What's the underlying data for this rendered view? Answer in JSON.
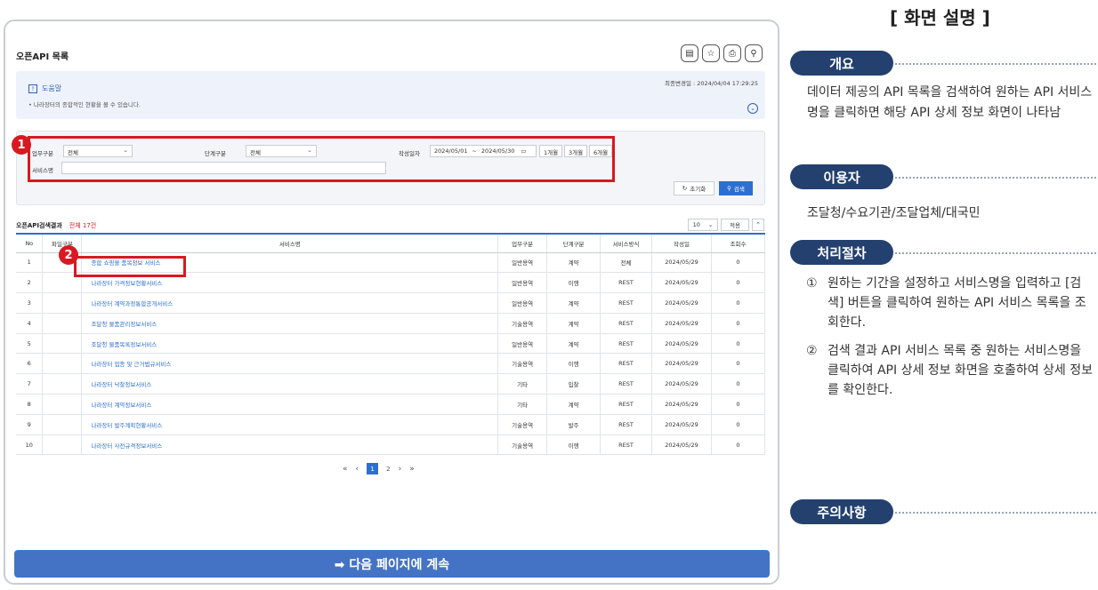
{
  "screen": {
    "title": "오픈API 목록",
    "tool_icons": [
      "bookmark-icon",
      "star-icon",
      "print-icon",
      "search-icon"
    ],
    "help": {
      "title": "도움말",
      "text": "• 나라장터의 종합적인 현황을 볼 수 있습니다.",
      "updated": "최종변경일 : 2024/04/04 17:29:25"
    },
    "search": {
      "task_label": "업무구분",
      "task_value": "전체",
      "stage_label": "단계구분",
      "stage_value": "전체",
      "date_label": "작성일자",
      "date_from": "2024/05/01",
      "date_sep": "~",
      "date_to": "2024/05/30",
      "quick": [
        "1개월",
        "3개월",
        "6개월"
      ],
      "service_label": "서비스명",
      "service_value": "",
      "reset_label": "초기화",
      "search_label": "검색"
    },
    "results": {
      "title": "오픈API검색결과",
      "count_label": "전체 17건",
      "page_size": "10",
      "apply_label": "적용",
      "columns": [
        "No",
        "파일구분",
        "서비스명",
        "업무구분",
        "단계구분",
        "서비스방식",
        "작성일",
        "조회수"
      ],
      "rows": [
        {
          "no": "1",
          "file": "",
          "service": "종합 쇼핑몰 품목정보 서비스",
          "task": "일반용역",
          "stage": "계약",
          "method": "전체",
          "date": "2024/05/29",
          "views": "0"
        },
        {
          "no": "2",
          "file": "",
          "service": "나라장터 가격정보현황서비스",
          "task": "일반용역",
          "stage": "이행",
          "method": "REST",
          "date": "2024/05/29",
          "views": "0"
        },
        {
          "no": "3",
          "file": "",
          "service": "나라장터 계약과정통합공개서비스",
          "task": "일반용역",
          "stage": "계약",
          "method": "REST",
          "date": "2024/05/29",
          "views": "0"
        },
        {
          "no": "4",
          "file": "",
          "service": "조달청 물품관리정보서비스",
          "task": "기술용역",
          "stage": "계약",
          "method": "REST",
          "date": "2024/05/29",
          "views": "0"
        },
        {
          "no": "5",
          "file": "",
          "service": "조달청 물품목록정보서비스",
          "task": "일반용역",
          "stage": "계약",
          "method": "REST",
          "date": "2024/05/29",
          "views": "0"
        },
        {
          "no": "6",
          "file": "",
          "service": "나라장터 업종 및 근거법규서비스",
          "task": "기술용역",
          "stage": "이행",
          "method": "REST",
          "date": "2024/05/29",
          "views": "0"
        },
        {
          "no": "7",
          "file": "",
          "service": "나라장터 낙찰정보서비스",
          "task": "기타",
          "stage": "입찰",
          "method": "REST",
          "date": "2024/05/29",
          "views": "0"
        },
        {
          "no": "8",
          "file": "",
          "service": "나라장터 계약정보서비스",
          "task": "기타",
          "stage": "계약",
          "method": "REST",
          "date": "2024/05/29",
          "views": "0"
        },
        {
          "no": "9",
          "file": "",
          "service": "나라장터 발주계획현황서비스",
          "task": "기술용역",
          "stage": "발주",
          "method": "REST",
          "date": "2024/05/29",
          "views": "0"
        },
        {
          "no": "10",
          "file": "",
          "service": "나라장터 사전규격정보서비스",
          "task": "기술용역",
          "stage": "이행",
          "method": "REST",
          "date": "2024/05/29",
          "views": "0"
        }
      ]
    },
    "pagination": {
      "pages": [
        "1",
        "2"
      ],
      "current": "1"
    },
    "continue_label": "➡ 다음 페이지에 계속"
  },
  "badges": {
    "one": "1",
    "two": "2"
  },
  "description": {
    "heading": "[ 화면 설명 ]",
    "overview_title": "개요",
    "overview_text": "데이터 제공의 API 목록을 검색하여 원하는 API 서비스명을 클릭하면 해당 API 상세 정보 화면이 나타남",
    "users_title": "이용자",
    "users_text": "조달청/수요기관/조달업체/대국민",
    "process_title": "처리절차",
    "step1_mark": "①",
    "step1_text": "원하는 기간을 설정하고 서비스명을 입력하고 [검색] 버튼을 클릭하여 원하는 API 서비스 목록을 조회한다.",
    "step2_mark": "②",
    "step2_text": "검색 결과 API 서비스 목록 중 원하는 서비스명을 클릭하여 API 상세 정보 화면을 호출하여 상세 정보를 확인한다.",
    "caution_title": "주의사항"
  },
  "colors": {
    "accent": "#2d6fd0",
    "highlight": "#d71921",
    "pill": "#23406f",
    "continue": "#4473c5"
  }
}
